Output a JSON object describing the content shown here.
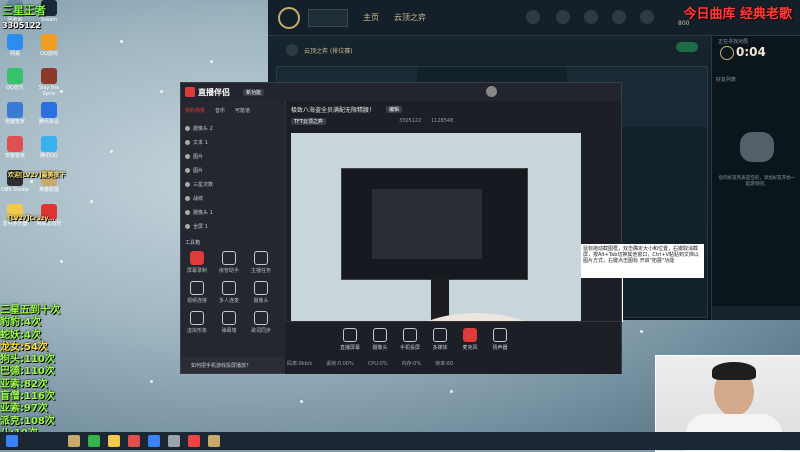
{
  "overlay": {
    "top_left_title": "三星王者",
    "top_left_sub": "3305122",
    "top_right": "今日曲库  经典老歌",
    "counter_list": [
      {
        "label": "三星五到十",
        "count": "次",
        "color": "#9CFF4B"
      },
      {
        "label": "豹豹:",
        "count": "4次",
        "color": "#9CFF4B"
      },
      {
        "label": "蛇妖:",
        "count": "4次",
        "color": "#9CFF4B"
      },
      {
        "label": "龙女:",
        "count": "54次",
        "color": "#FFE23B"
      },
      {
        "label": "狗头:",
        "count": "110次",
        "color": "#9CFF4B"
      },
      {
        "label": "巴德:",
        "count": "110次",
        "color": "#9CFF4B"
      },
      {
        "label": "亚索:",
        "count": "82次",
        "color": "#9CFF4B"
      },
      {
        "label": "盲僧:",
        "count": "116次",
        "color": "#9CFF4B"
      },
      {
        "label": "亚索:",
        "count": "97次",
        "color": "#9CFF4B"
      },
      {
        "label": "派克:",
        "count": "108次",
        "color": "#9CFF4B"
      },
      {
        "label": "八:",
        "count": "19次",
        "color": "#9CFF4B"
      }
    ]
  },
  "desktop_icons": [
    {
      "label": "回收站",
      "color": "#6c8aa0"
    },
    {
      "label": "Steam",
      "color": "#1b2838"
    },
    {
      "label": "网易",
      "color": "#2d8cf0"
    },
    {
      "label": "QQ游戏",
      "color": "#f0a020"
    },
    {
      "label": "QQ音乐",
      "color": "#36c26b"
    },
    {
      "label": "Slay the Spire",
      "color": "#8a3a2a"
    },
    {
      "label": "电脑管家",
      "color": "#3a7bd5"
    },
    {
      "label": "腾讯会议",
      "color": "#2b6fe0"
    },
    {
      "label": "安装管家",
      "color": "#e05050"
    },
    {
      "label": "腾讯QQ",
      "color": "#3bb0f0"
    },
    {
      "label": "OBS Studio",
      "color": "#302e31"
    },
    {
      "label": "英雄联盟",
      "color": "#c8aa6e"
    },
    {
      "label": "雷电多开器",
      "color": "#f2c94c"
    },
    {
      "label": "网易云音乐",
      "color": "#d33"
    }
  ],
  "desktop_overlay_text": [
    "欢迎[LV27]最美夜下",
    "[LV27]Crazy..."
  ],
  "lol_client": {
    "nav_home": "主页",
    "nav_mode": "云顶之弈",
    "mode_title": "云顶之弈 (排位赛)",
    "currency": "800",
    "timer_label": "正在寻找对局",
    "timer": "0:04",
    "friends_label": "好友列表",
    "side_text": "您的好友列表是空的，添加好友开始一起游戏吧。"
  },
  "stream_app": {
    "app_name": "直播伴侣",
    "tag": "新功能",
    "tabs": [
      "我的场景",
      "音乐",
      "可能道"
    ],
    "stream_title": "极致八海盗全员满配无限精腰！",
    "edit_label": "编辑",
    "game_tag": "TFT云顶之弈",
    "room_id": "3305122",
    "likes": "1128548",
    "scenes": [
      "摄像头 2",
      "文本 1",
      "图片",
      "图片",
      "三星次数",
      "战绩",
      "摄像头 1",
      "全屏 1"
    ],
    "tools_header": "工具箱",
    "tools": [
      "屏幕录制",
      "房管助手",
      "主播任务",
      "视频连接",
      "多人连麦",
      "摄像头",
      "虚拟形象",
      "弹幕墙",
      "歌词同步"
    ],
    "bottom_buttons": [
      "直播屏幕",
      "摄像头",
      "手机投屏",
      "多媒体",
      "麦克风",
      "扬声器"
    ],
    "bottom_hint": "如何把手机游戏投屏播放？",
    "footer_stats": [
      "码率:0kb/s",
      "丢帧:0.00%",
      "CPU:0%",
      "内存:0%",
      "帧率:60"
    ]
  },
  "tooltip_note": "鼠标拖动截图框，双击确定大小和位置，右键取消截屏，按Alt+Tab切换其他窗口，Ctrl+V粘贴到文档以图片方式，右键点击图标  开启\"拓展\"功能",
  "taskbar": {
    "items_colors": [
      "#c8aa6e",
      "#35b34a",
      "#f2c94c",
      "#e05050",
      "#3b82f6",
      "#9ca3af",
      "#ef4444",
      "#c8aa6e"
    ]
  },
  "colors": {
    "lol_gold": "#c8aa6e",
    "counter_green": "#9CFF4B",
    "overlay_red": "#ff3b3b",
    "app_accent": "#e03b3b"
  }
}
